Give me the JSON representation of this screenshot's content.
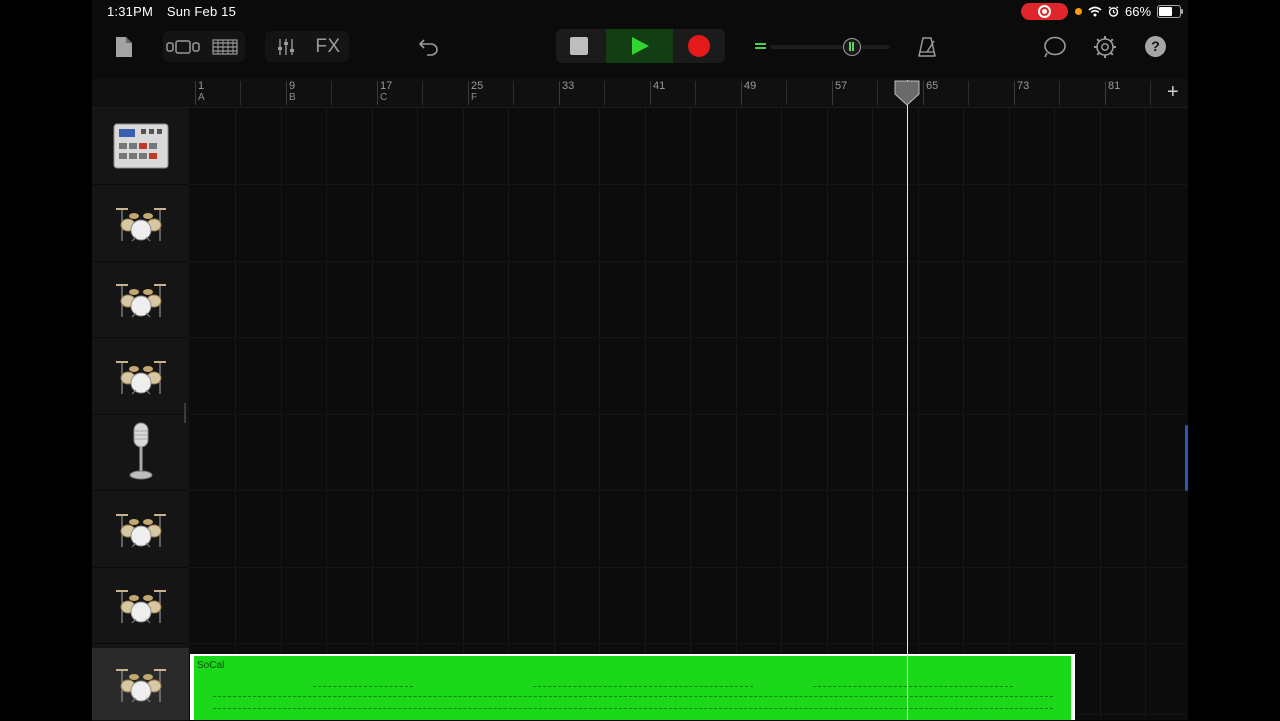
{
  "status_bar": {
    "time": "1:31PM",
    "date": "Sun Feb 15",
    "battery_percent": "66%",
    "battery_level": 0.66
  },
  "toolbar": {
    "fx_label": "FX",
    "help_label": "?",
    "icons": [
      "document-icon",
      "loop-browser-icon",
      "tracks-view-icon",
      "mixer-icon",
      "undo-icon",
      "stop-icon",
      "play-icon",
      "record-icon",
      "master-volume-icon",
      "metronome-icon",
      "loop-icon",
      "settings-icon",
      "help-icon"
    ]
  },
  "ruler": {
    "bars": [
      {
        "num": "1",
        "section": "A"
      },
      {
        "num": "9",
        "section": "B"
      },
      {
        "num": "17",
        "section": "C"
      },
      {
        "num": "25",
        "section": "F"
      },
      {
        "num": "33",
        "section": ""
      },
      {
        "num": "41",
        "section": ""
      },
      {
        "num": "49",
        "section": ""
      },
      {
        "num": "57",
        "section": ""
      },
      {
        "num": "65",
        "section": ""
      },
      {
        "num": "73",
        "section": ""
      },
      {
        "num": "81",
        "section": ""
      }
    ],
    "add_label": "+"
  },
  "tracks": [
    {
      "instrument": "drum-machine-icon"
    },
    {
      "instrument": "drum-kit-icon"
    },
    {
      "instrument": "drum-kit-icon"
    },
    {
      "instrument": "drum-kit-icon"
    },
    {
      "instrument": "microphone-icon"
    },
    {
      "instrument": "drum-kit-icon"
    },
    {
      "instrument": "drum-kit-icon"
    },
    {
      "instrument": "drum-kit-icon",
      "selected": true
    }
  ],
  "region": {
    "name": "SoCal",
    "color": "#1bd81b"
  },
  "colors": {
    "play": "#2fd62f",
    "record": "#e41a1a",
    "status_record": "#e0262b",
    "accent_blue": "#2c58b0"
  }
}
